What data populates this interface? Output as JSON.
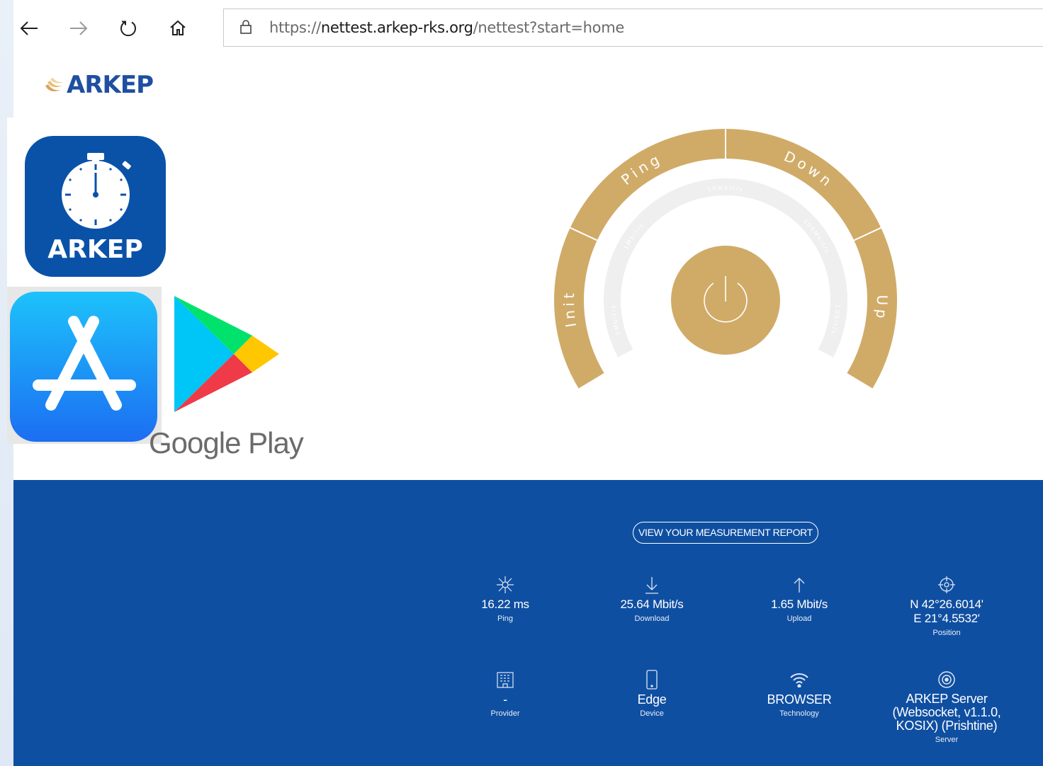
{
  "browser": {
    "url_scheme": "https://",
    "url_host": "nettest.arkep-rks.org",
    "url_path": "/nettest?start=home",
    "icons": [
      "back-icon",
      "forward-icon",
      "refresh-icon",
      "home-icon",
      "lock-icon"
    ]
  },
  "header": {
    "logo_text": "ARKEP"
  },
  "apps": {
    "arkep_app_label": "ARKEP",
    "google_play_label": "Google Play"
  },
  "gauge": {
    "phases": [
      "Init",
      "Ping",
      "Down",
      "Up"
    ],
    "scale_labels": [
      "0Mbit/s",
      "1Mbit/s",
      "10Mbit/s",
      "100Mbit/s",
      "1Gbit/s"
    ],
    "colors": {
      "ring": "#d0ab68",
      "inner": "#efefef",
      "button": "#d0ab68"
    }
  },
  "panel": {
    "report_button": "VIEW YOUR MEASUREMENT REPORT",
    "stats": [
      {
        "icon": "ping-icon",
        "value": "16.22 ms",
        "label": "Ping"
      },
      {
        "icon": "download-icon",
        "value": "25.64 Mbit/s",
        "label": "Download"
      },
      {
        "icon": "upload-icon",
        "value": "1.65 Mbit/s",
        "label": "Upload"
      },
      {
        "icon": "position-icon",
        "value": "N 42°26.6014'",
        "value2": "E 21°4.5532'",
        "label": "Position"
      }
    ],
    "details": [
      {
        "icon": "provider-icon",
        "value": "-",
        "label": "Provider"
      },
      {
        "icon": "device-icon",
        "value": "Edge",
        "label": "Device"
      },
      {
        "icon": "wifi-icon",
        "value": "BROWSER",
        "label": "Technology"
      },
      {
        "icon": "server-icon",
        "value": "ARKEP Server",
        "value2": "(Websocket, v1.1.0,",
        "value3": "KOSIX) (Prishtine)",
        "label": "Server"
      }
    ],
    "colors": {
      "background": "#0f4fa2",
      "text": "#ffffff"
    }
  }
}
